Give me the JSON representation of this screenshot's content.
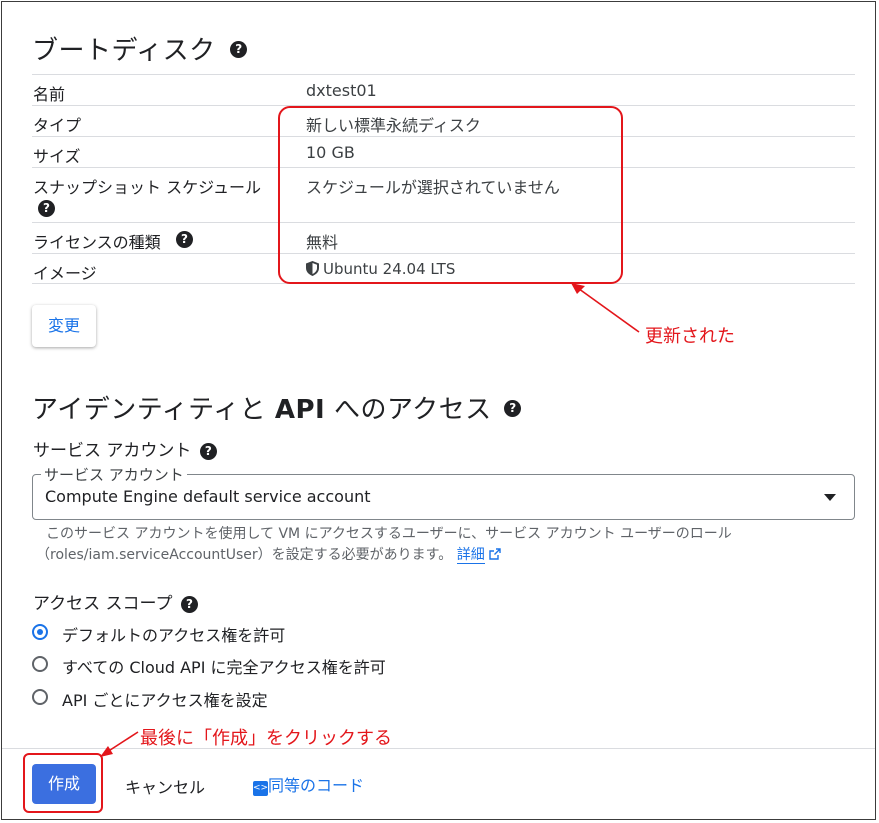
{
  "boot_disk": {
    "title": "ブートディスク",
    "rows": [
      {
        "key": "名前",
        "value": "dxtest01"
      },
      {
        "key": "タイプ",
        "value": "新しい標準永続ディスク"
      },
      {
        "key": "サイズ",
        "value": "10 GB"
      },
      {
        "key": "スナップショット スケジュール",
        "value": "スケジュールが選択されていません"
      },
      {
        "key": "ライセンスの種類",
        "value": "無料"
      },
      {
        "key": "イメージ",
        "value": "Ubuntu 24.04 LTS"
      }
    ],
    "change_button": "変更"
  },
  "identity": {
    "title_part1": "アイデンティティと ",
    "title_api": "API",
    "title_part2": " へのアクセス",
    "service_account_label": "サービス アカウント",
    "select_legend": "サービス アカウント",
    "select_value": "Compute Engine default service account",
    "hint_line1": "このサービス アカウントを使用して VM にアクセスするユーザーに、サービス アカウント ユーザーのロール",
    "hint_line2": "（roles/iam.serviceAccountUser）を設定する必要があります。",
    "hint_link": "詳細",
    "access_scope_label": "アクセス スコープ",
    "scopes": [
      {
        "label": "デフォルトのアクセス権を許可",
        "selected": true
      },
      {
        "label": "すべての Cloud API に完全アクセス権を許可",
        "selected": false
      },
      {
        "label": "API ごとにアクセス権を設定",
        "selected": false
      }
    ]
  },
  "footer": {
    "create": "作成",
    "cancel": "キャンセル",
    "equivalent_code": "同等のコード"
  },
  "annotations": {
    "updated": "更新された",
    "final_step": "最後に「作成」をクリックする",
    "color": "#e3161b"
  },
  "colors": {
    "accent": "#1a73e8",
    "primary_button": "#3b6fe0"
  }
}
